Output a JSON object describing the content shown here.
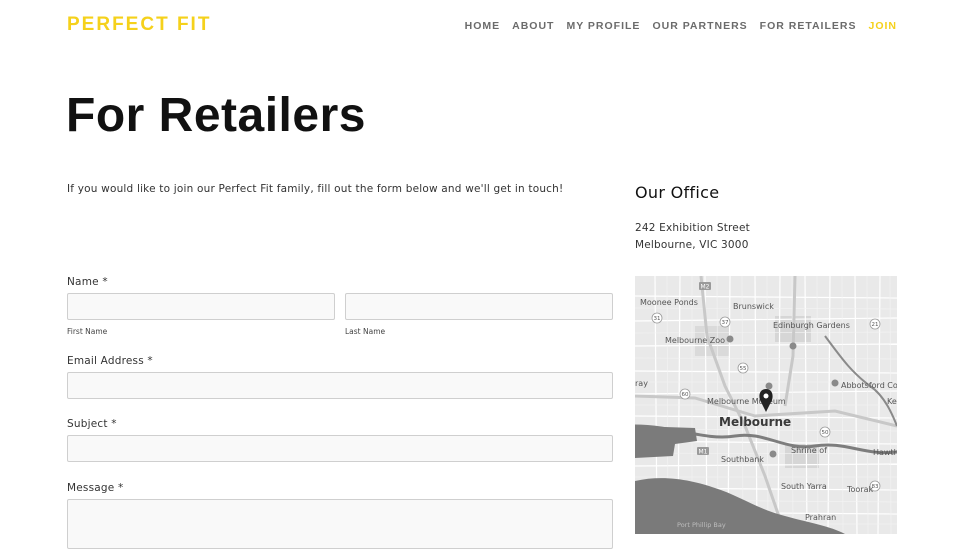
{
  "header": {
    "logo": "PERFECT FIT",
    "nav": [
      {
        "label": "HOME"
      },
      {
        "label": "ABOUT"
      },
      {
        "label": "MY PROFILE"
      },
      {
        "label": "OUR PARTNERS"
      },
      {
        "label": "FOR RETAILERS"
      },
      {
        "label": "JOIN"
      }
    ]
  },
  "main": {
    "title": "For Retailers",
    "intro": "If you would like to join our Perfect Fit family, fill out the form below and we'll get in touch!",
    "form": {
      "name_label": "Name *",
      "first_name_sublabel": "First Name",
      "last_name_sublabel": "Last Name",
      "email_label": "Email Address *",
      "subject_label": "Subject *",
      "message_label": "Message *"
    }
  },
  "sidebar": {
    "office_title": "Our Office",
    "address_line1": "242 Exhibition Street",
    "address_line2": "Melbourne, VIC 3000"
  },
  "map": {
    "labels": {
      "m2": "M2",
      "moonee_ponds": "Moonee Ponds",
      "brunswick": "Brunswick",
      "edinburgh_gardens": "Edinburgh Gardens",
      "melbourne_zoo": "Melbourne Zoo",
      "ray": "ray",
      "abbotsford": "Abbotsford Co",
      "melbourne_museum": "Melbourne Museum",
      "ke": "Ke",
      "melbourne": "Melbourne",
      "m1": "M1",
      "southbank": "Southbank",
      "shrine1": "Shrine of",
      "shrine2": "Remembrance",
      "hawthorn": "Hawth",
      "south_yarra": "South Yarra",
      "toorak": "Toorak",
      "prahran": "Prahran",
      "port_phillip_bay": "Port Phillip Bay",
      "route_31": "31",
      "route_37": "37",
      "route_55": "55",
      "route_60": "60",
      "route_21": "21",
      "route_50": "50",
      "route_83": "83"
    }
  }
}
